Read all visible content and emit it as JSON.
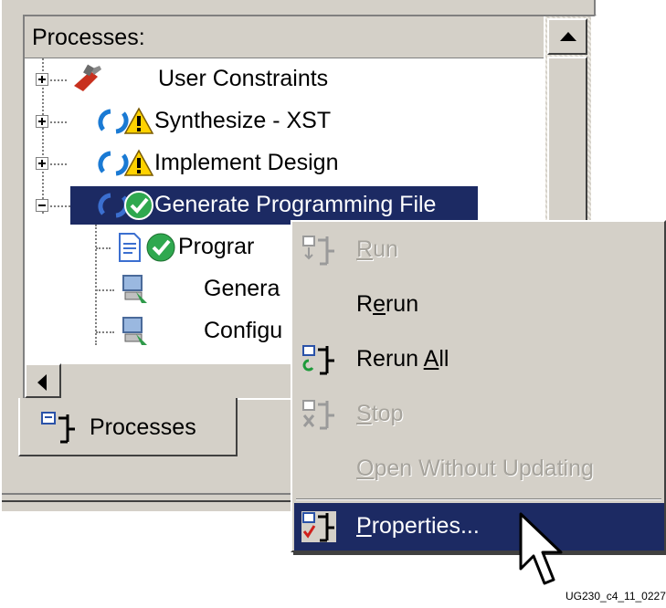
{
  "panel": {
    "header": "Processes:",
    "tab_label": "Processes"
  },
  "tree": [
    {
      "label": "User Constraints",
      "expander": "plus",
      "icon": "user-constraints-icon",
      "selected": false
    },
    {
      "label": "Synthesize - XST",
      "expander": "plus",
      "icon": "refresh-warning-icon",
      "selected": false
    },
    {
      "label": "Implement Design",
      "expander": "plus",
      "icon": "refresh-warning-icon",
      "selected": false
    },
    {
      "label": "Generate Programming File",
      "expander": "minus",
      "icon": "refresh-check-icon",
      "selected": true
    },
    {
      "label": "Prograr",
      "icon": "document-check-icon",
      "selected": false
    },
    {
      "label": "Genera",
      "icon": "computer-process-icon",
      "selected": false
    },
    {
      "label": "Configu",
      "icon": "computer-process-icon",
      "selected": false
    }
  ],
  "context_menu": {
    "items": [
      {
        "label_pre": "",
        "label_u": "R",
        "label_post": "un",
        "enabled": false,
        "icon": "run-icon"
      },
      {
        "label_pre": "R",
        "label_u": "e",
        "label_post": "run",
        "enabled": true,
        "icon": ""
      },
      {
        "label_pre": "Rerun ",
        "label_u": "A",
        "label_post": "ll",
        "enabled": true,
        "icon": "rerun-all-icon"
      },
      {
        "label_pre": "",
        "label_u": "S",
        "label_post": "top",
        "enabled": false,
        "icon": "stop-icon"
      },
      {
        "label_pre": "",
        "label_u": "O",
        "label_post": "pen Without Updating",
        "enabled": false,
        "icon": ""
      },
      {
        "label_pre": "",
        "label_u": "P",
        "label_post": "roperties...",
        "enabled": true,
        "selected": true,
        "icon": "properties-icon"
      }
    ]
  },
  "caption": "UG230_c4_11_0227("
}
